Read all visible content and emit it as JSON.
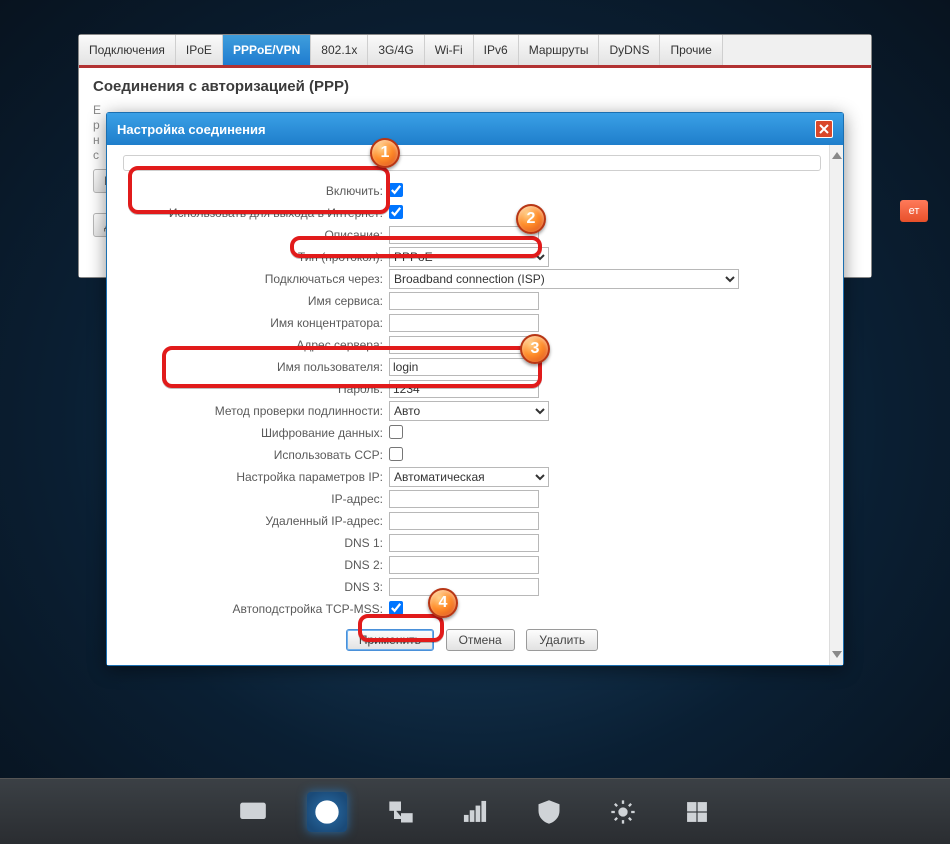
{
  "tabs": {
    "items": [
      {
        "label": "Подключения"
      },
      {
        "label": "IPoE"
      },
      {
        "label": "PPPoE/VPN"
      },
      {
        "label": "802.1x"
      },
      {
        "label": "3G/4G"
      },
      {
        "label": "Wi-Fi"
      },
      {
        "label": "IPv6"
      },
      {
        "label": "Маршруты"
      },
      {
        "label": "DyDNS"
      },
      {
        "label": "Прочие"
      }
    ],
    "active_index": 2
  },
  "page": {
    "title": "Соединения с авторизацией (PPP)",
    "add_button": "До",
    "badge_text": "ет"
  },
  "dialog": {
    "title": "Настройка соединения",
    "fields": {
      "enable": {
        "label": "Включить:",
        "checked": true
      },
      "use_for_internet": {
        "label": "Использовать для выхода в Интернет:",
        "checked": true
      },
      "description": {
        "label": "Описание:",
        "value": ""
      },
      "protocol": {
        "label": "Тип (протокол):",
        "value": "PPPoE"
      },
      "connect_via": {
        "label": "Подключаться через:",
        "value": "Broadband connection (ISP)"
      },
      "service_name": {
        "label": "Имя сервиса:",
        "value": ""
      },
      "concentrator": {
        "label": "Имя концентратора:",
        "value": ""
      },
      "server_addr": {
        "label": "Адрес сервера:",
        "value": ""
      },
      "username": {
        "label": "Имя пользователя:",
        "value": "login"
      },
      "password": {
        "label": "Пароль:",
        "value": "1234"
      },
      "auth_method": {
        "label": "Метод проверки подлинности:",
        "value": "Авто"
      },
      "encryption": {
        "label": "Шифрование данных:",
        "checked": false
      },
      "use_ccp": {
        "label": "Использовать CCP:",
        "checked": false
      },
      "ip_config": {
        "label": "Настройка параметров IP:",
        "value": "Автоматическая"
      },
      "ip_addr": {
        "label": "IP-адрес:",
        "value": ""
      },
      "remote_ip": {
        "label": "Удаленный IP-адрес:",
        "value": ""
      },
      "dns1": {
        "label": "DNS 1:",
        "value": ""
      },
      "dns2": {
        "label": "DNS 2:",
        "value": ""
      },
      "dns3": {
        "label": "DNS 3:",
        "value": ""
      },
      "tcp_mss": {
        "label": "Автоподстройка TCP-MSS:",
        "checked": true
      }
    },
    "buttons": {
      "apply": "Применить",
      "cancel": "Отмена",
      "delete": "Удалить"
    }
  },
  "annotations": {
    "m1": "1",
    "m2": "2",
    "m3": "3",
    "m4": "4"
  },
  "dock": {
    "items": [
      {
        "name": "monitor-icon"
      },
      {
        "name": "globe-icon"
      },
      {
        "name": "network-icon"
      },
      {
        "name": "signal-icon"
      },
      {
        "name": "shield-icon"
      },
      {
        "name": "gear-icon"
      },
      {
        "name": "apps-icon"
      }
    ],
    "active_index": 1
  }
}
